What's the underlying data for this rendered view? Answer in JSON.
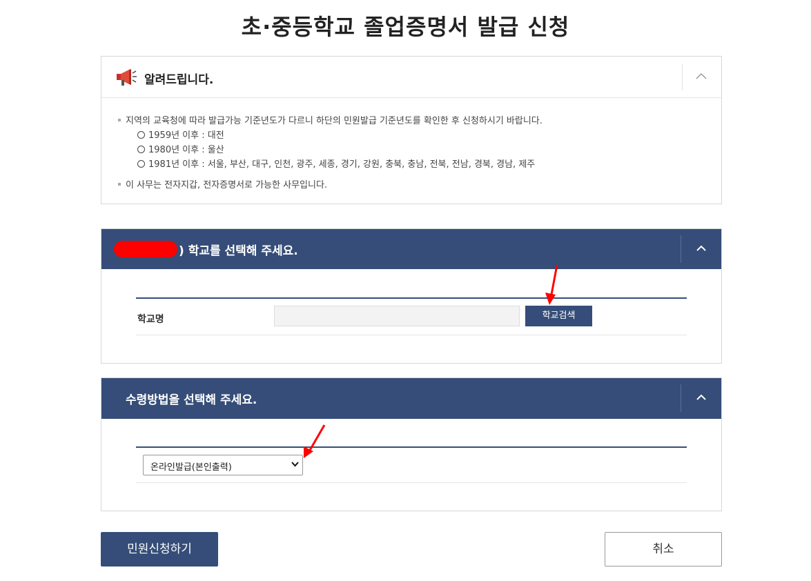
{
  "page_title": "초·중등학교 졸업증명서 발급 신청",
  "notice": {
    "title": "알려드립니다.",
    "line1": "지역의 교육청에 따라 발급가능 기준년도가 다르니 하단의 민원발급 기준년도를 확인한 후 신청하시기 바랍니다.",
    "sub": [
      "1959년 이후 : 대전",
      "1980년 이후 : 울산",
      "1981년 이후 : 서울, 부산, 대구, 인천, 광주, 세종, 경기, 강원, 충북, 충남, 전북, 전남, 경북, 경남, 제주"
    ],
    "line2": "이 사무는 전자지갑, 전자증명서로 가능한 사무입니다."
  },
  "school_section": {
    "title": ") 학교를 선택해 주세요.",
    "field_label": "학교명",
    "input_value": "",
    "search_button": "학교검색"
  },
  "receipt_section": {
    "title": "수령방법을 선택해 주세요.",
    "selected_option": "온라인발급(본인출력)"
  },
  "buttons": {
    "apply": "민원신청하기",
    "cancel": "취소"
  },
  "colors": {
    "primary": "#354d78",
    "annotation_arrow": "#ff0000"
  },
  "icons": [
    "megaphone-icon",
    "chevron-up-icon",
    "chevron-down-icon"
  ]
}
